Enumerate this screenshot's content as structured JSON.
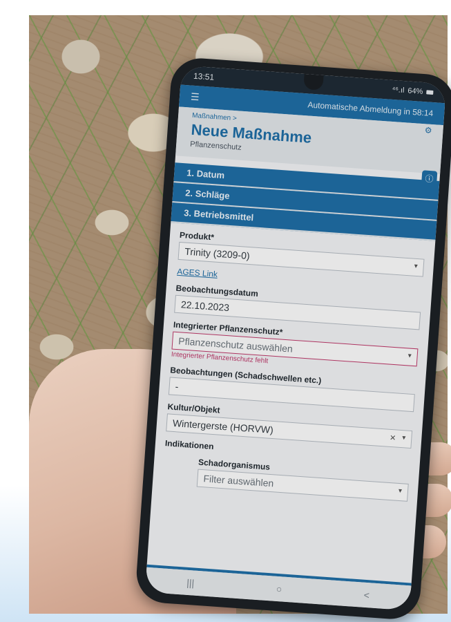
{
  "status_bar": {
    "time": "13:51",
    "signal": "⁴⁶.ıl",
    "battery": "64%"
  },
  "app_bar": {
    "menu_icon": "menu-icon",
    "auto_logout": "Automatische Abmeldung in 58:14"
  },
  "header": {
    "breadcrumb": "Maßnahmen >",
    "title": "Neue Maßnahme",
    "subtitle": "Pflanzenschutz",
    "settings_icon": "settings-icon"
  },
  "steps": [
    {
      "label": "1. Datum"
    },
    {
      "label": "2. Schläge"
    },
    {
      "label": "3. Betriebsmittel"
    }
  ],
  "form": {
    "produkt": {
      "label": "Produkt*",
      "value": "Trinity (3209-0)"
    },
    "ages_link": "AGES Link",
    "beobachtungsdatum": {
      "label": "Beobachtungsdatum",
      "value": "22.10.2023"
    },
    "integrierter": {
      "label": "Integrierter Pflanzenschutz*",
      "placeholder": "Pflanzenschutz auswählen",
      "error": "Integrierter Pflanzenschutz fehlt"
    },
    "beobachtungen": {
      "label": "Beobachtungen (Schadschwellen etc.)",
      "value": "-"
    },
    "kultur": {
      "label": "Kultur/Objekt",
      "value": "Wintergerste (HORVW)"
    },
    "indikationen": "Indikationen",
    "schadorganismus": {
      "label": "Schadorganismus",
      "placeholder": "Filter auswählen"
    }
  },
  "nav": {
    "recent": "|||",
    "home": "○",
    "back": "<"
  },
  "colors": {
    "primary": "#1f6fa8",
    "error": "#c0396b",
    "status_bar": "#1f2b36"
  }
}
